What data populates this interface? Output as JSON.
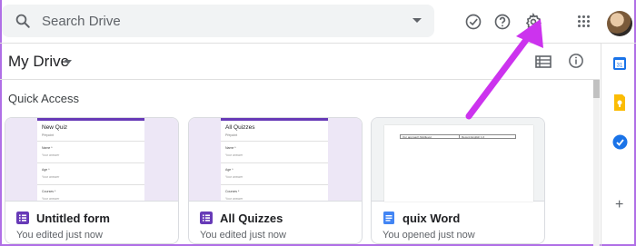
{
  "search": {
    "placeholder": "Search Drive"
  },
  "header_icons": [
    "offline-check-icon",
    "help-icon",
    "settings-gear-icon",
    "apps-grid-icon"
  ],
  "location": {
    "title": "My Drive"
  },
  "quick_access": {
    "title": "Quick Access",
    "cards": [
      {
        "name": "Untitled form",
        "subtitle": "You edited just now",
        "type": "form",
        "accent": "#673ab7",
        "preview": {
          "title": "New Quiz",
          "subtitle": "Přepoint",
          "questions": [
            {
              "label": "Name *",
              "answer": "Your answer"
            },
            {
              "label": "Age *",
              "answer": "Your answer"
            },
            {
              "label": "Courses *",
              "answer": "Your answer"
            }
          ]
        }
      },
      {
        "name": "All Quizzes",
        "subtitle": "You edited just now",
        "type": "form",
        "accent": "#673ab7",
        "preview": {
          "title": "All Quizzes",
          "subtitle": "Přepoint",
          "questions": [
            {
              "label": "Name *",
              "answer": "Your answer"
            },
            {
              "label": "Age *",
              "answer": "Your answer"
            },
            {
              "label": "Courses *",
              "answer": "Your answer"
            }
          ]
        }
      },
      {
        "name": "quix Word",
        "subtitle": "You opened just now",
        "type": "doc",
        "accent": "#4285f4",
        "preview": {
          "cells": [
            "Our approach Multilevel.",
            "Recent English 1.0"
          ]
        }
      }
    ]
  },
  "side_panel_icons": [
    "calendar-icon",
    "keep-icon",
    "tasks-icon",
    "add-icon"
  ],
  "colors": {
    "annotation_arrow": "#cc33ee",
    "form_accent": "#673ab7",
    "docs_blue": "#4285f4"
  },
  "side_panel": {
    "add_label": "+"
  }
}
